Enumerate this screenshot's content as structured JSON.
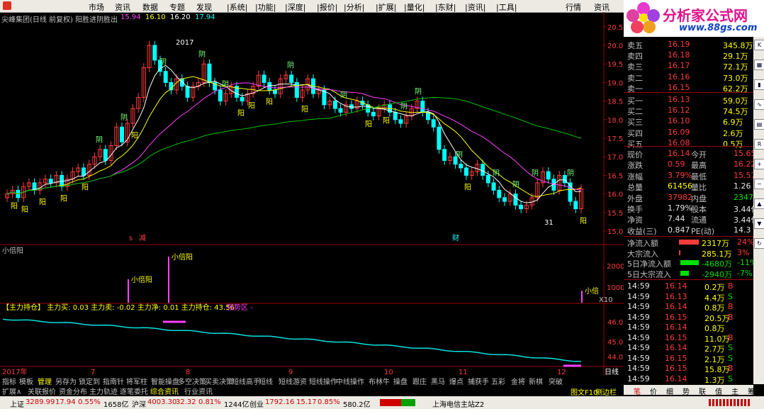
{
  "menu": [
    "市场",
    "资讯",
    "数据",
    "专题",
    "发现",
    "|系统|",
    "|功能|",
    "|深度|",
    "|报价|",
    "|分析|",
    "|扩展|",
    "|量化|",
    "|东财|",
    "|资讯|",
    "|工具|",
    "行情",
    "资讯"
  ],
  "brand": {
    "name": "分析家公式网",
    "url": "www.88gs.com"
  },
  "chart_title": "尖峰集团(日线 前复权) 阳胜进阴胜出",
  "chart_vals": [
    "15.94",
    "16.10",
    "16.20",
    "17.94"
  ],
  "price_axis": [
    "20.5",
    "20.00",
    "19.50",
    "19.00",
    "18.50",
    "18.00",
    "17.50",
    "17.00",
    "16.50",
    "16.00",
    "15.50",
    "15.00"
  ],
  "annotations": {
    "peak": "2017",
    "low": "31",
    "ind_label": "小倍阳",
    "ind_mark": "小倍阳",
    "ind_mark_cut": "小倍"
  },
  "ind_axis": [
    "20000",
    "10000",
    "X10"
  ],
  "flow_label": "【主力持仓】 主力买: 0.03  主力卖: -0.02  主力净: 0.01  主力持仓: 43.56",
  "flow_tag": "强势区 -",
  "flow_axis": [
    "46.00",
    "45.00",
    "44.00"
  ],
  "dates": [
    "2017年",
    "7",
    "8",
    "9",
    "10",
    "11",
    "12",
    "日线"
  ],
  "tabs1": [
    "指标",
    "模板",
    "管理",
    "另存为",
    "锁定到",
    "指南针",
    "将军柱",
    "智能操盘",
    "多空决策",
    "买卖决策",
    "短线高手",
    "短线",
    "短线游资",
    "短线操作",
    "中线操作",
    "布林牛",
    "操盘",
    "跟庄",
    "黑马",
    "爆点",
    "捕获手",
    "五彩",
    "金将",
    "新棋",
    "突破"
  ],
  "tabs2": [
    "扩展∧",
    "关联报价",
    "资金分布",
    "主力轨迹",
    "逐笔委托",
    "综合资讯",
    "行业资讯"
  ],
  "orderbook": {
    "sell": [
      {
        "label": "卖五",
        "price": "16.19",
        "vol": "345.8万"
      },
      {
        "label": "卖四",
        "price": "16.18",
        "vol": "29.1万"
      },
      {
        "label": "卖三",
        "price": "16.17",
        "vol": "72.1万"
      },
      {
        "label": "卖二",
        "price": "16.16",
        "vol": "73.0万"
      },
      {
        "label": "卖一",
        "price": "16.15",
        "vol": "62.2万"
      }
    ],
    "buy": [
      {
        "label": "买一",
        "price": "16.13",
        "vol": "59.0万"
      },
      {
        "label": "买二",
        "price": "16.12",
        "vol": "74.5万"
      },
      {
        "label": "买三",
        "price": "16.10",
        "vol": "6.9万"
      },
      {
        "label": "买四",
        "price": "16.09",
        "vol": "2.6万"
      },
      {
        "label": "买五",
        "price": "16.08",
        "vol": "0.5万"
      }
    ]
  },
  "quote": [
    {
      "l1": "现价",
      "v1": "16.14",
      "l2": "今开",
      "v2": "15.65"
    },
    {
      "l1": "涨跌",
      "v1": "0.59",
      "l2": "最高",
      "v2": "16.22"
    },
    {
      "l1": "涨幅",
      "v1": "3.79%",
      "l2": "最低",
      "v2": "15.57"
    },
    {
      "l1": "总量",
      "v1": "61456",
      "l2": "量比",
      "v2": "1.26"
    },
    {
      "l1": "外盘",
      "v1": "37982",
      "l2": "内盘",
      "v2": "23473"
    },
    {
      "l1": "换手",
      "v1": "1.79%",
      "l2": "股本",
      "v2": "3.44亿"
    },
    {
      "l1": "净资",
      "v1": "7.44",
      "l2": "流通",
      "v2": "3.44亿"
    },
    {
      "l1": "收益(三)",
      "v1": "0.847",
      "l2": "PE(动)",
      "v2": "14.3"
    }
  ],
  "flows": [
    {
      "label": "净流入额",
      "value": "2317万",
      "pct": "24%"
    },
    {
      "label": "大宗流入",
      "value": "285.1万",
      "pct": "3%"
    },
    {
      "label": "5日净流入额",
      "value": "-4680万",
      "pct": "-11%"
    },
    {
      "label": "5日大宗流入",
      "value": "-2940万",
      "pct": "-7%"
    }
  ],
  "ticks": [
    {
      "t": "14:59",
      "p": "16.14",
      "v": "0.2万",
      "s": "B"
    },
    {
      "t": "14:59",
      "p": "16.13",
      "v": "4.4万",
      "s": "S"
    },
    {
      "t": "14:59",
      "p": "16.14",
      "v": "0.8万",
      "s": "B"
    },
    {
      "t": "14:59",
      "p": "16.15",
      "v": "20.5万",
      "s": "B"
    },
    {
      "t": "14:59",
      "p": "16.14",
      "v": "0.8万",
      "s": ""
    },
    {
      "t": "14:59",
      "p": "16.15",
      "v": "11.0万",
      "s": "B"
    },
    {
      "t": "14:59",
      "p": "16.14",
      "v": "2.7万",
      "s": "S"
    },
    {
      "t": "14:59",
      "p": "16.15",
      "v": "2.1万",
      "s": "S"
    },
    {
      "t": "14:59",
      "p": "16.15",
      "v": "15.8万",
      "s": "B"
    },
    {
      "t": "14:59",
      "p": "16.14",
      "v": "1.3万",
      "s": "S"
    }
  ],
  "right_tabs": [
    "笔",
    "价",
    "细",
    "势",
    "联",
    "值",
    "主",
    "筹"
  ],
  "status": {
    "sh_label": "上证",
    "sh": "3289.99",
    "sh_chg": "17.94",
    "sh_pct": "0.55%",
    "sh_amt": "1658亿",
    "sz_label": "沪深",
    "sz": "4003.30",
    "sz_chg": "32.32",
    "sz_pct": "0.81%",
    "sz_amt": "1244亿",
    "cy_label": "创业",
    "cy": "1792.16",
    "cy_chg": "15.17",
    "cy_pct": "0.85%",
    "cy_amt": "580.2亿",
    "server": "上海电信主站Z2",
    "f10": "图文F10",
    "side": "侧边栏",
    "arrows": "◀ ▶"
  },
  "colors": {
    "up": "#ff3c3c",
    "down": "#00ffff",
    "ma5": "#ffffff",
    "ma10": "#ffff00",
    "ma20": "#ff40ff",
    "ma60": "#00c000",
    "flow": "#00e0e0"
  }
}
